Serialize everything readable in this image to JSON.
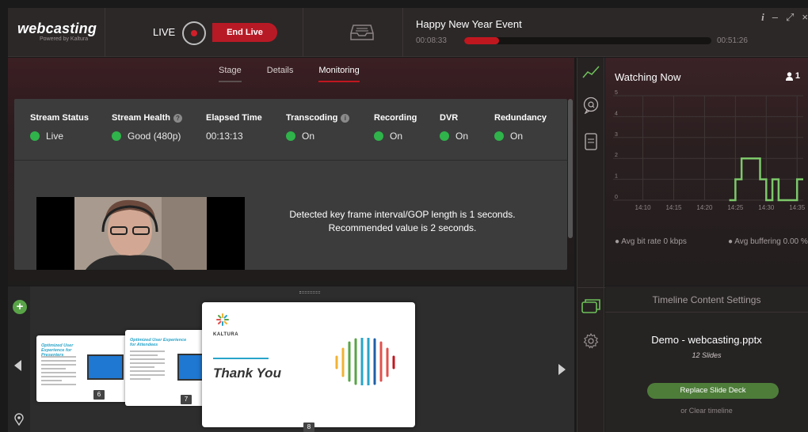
{
  "app": {
    "brand": "webcasting",
    "brand_sub": "Powered by Kaltura"
  },
  "header": {
    "live_label": "LIVE",
    "end_live_label": "End Live",
    "event_title": "Happy New Year Event",
    "elapsed": "00:08:33",
    "total": "00:51:26",
    "progress_fraction": 0.14,
    "window_controls": [
      "i",
      "–",
      "⤢",
      "×"
    ]
  },
  "stage": {
    "tabs": [
      {
        "label": "Stage",
        "active": false
      },
      {
        "label": "Details",
        "active": false
      },
      {
        "label": "Monitoring",
        "active": true
      }
    ],
    "stats": [
      {
        "header": "Stream Status",
        "value": "Live",
        "info": false
      },
      {
        "header": "Stream Health",
        "value": "Good (480p)",
        "info": true
      },
      {
        "header": "Elapsed Time",
        "value": "00:13:13",
        "info": false
      },
      {
        "header": "Transcoding",
        "value": "On",
        "info": true
      },
      {
        "header": "Recording",
        "value": "On",
        "info": false
      },
      {
        "header": "DVR",
        "value": "On",
        "info": false
      },
      {
        "header": "Redundancy",
        "value": "On",
        "info": false
      }
    ],
    "warning_line1": "Detected key frame interval/GOP length is 1 seconds.",
    "warning_line2": "Recommended value is 2 seconds."
  },
  "watching": {
    "title": "Watching Now",
    "viewer_count": "1",
    "avg_bit_rate": "Avg bit rate 0 kbps",
    "avg_buffering": "Avg buffering 0.00 %"
  },
  "chart_data": {
    "type": "line",
    "x_ticks": [
      "14:10",
      "14:15",
      "14:20",
      "14:25",
      "14:30",
      "14:35"
    ],
    "y_ticks": [
      "0",
      "1",
      "2",
      "3",
      "4",
      "5"
    ],
    "ylim": [
      0,
      5
    ],
    "color": "#7cc86a",
    "x": [
      "14:24",
      "14:25",
      "14:26",
      "14:27",
      "14:28",
      "14:29",
      "14:30",
      "14:31",
      "14:32",
      "14:33",
      "14:34",
      "14:35",
      "14:36"
    ],
    "values": [
      0,
      1,
      2,
      2,
      2,
      1,
      0,
      1,
      0,
      0,
      0,
      1,
      1
    ]
  },
  "slides": {
    "thumbs": [
      {
        "number": "6",
        "title": "Optimized User Experience for Presenters"
      },
      {
        "number": "7",
        "title": "Optimized User Experience for Attendees"
      }
    ],
    "current": {
      "number": "8",
      "logo_text": "KALTURA",
      "heading": "Thank You"
    }
  },
  "timeline": {
    "title": "Timeline Content Settings",
    "deck_name": "Demo - webcasting.pptx",
    "slide_count": "12 Slides",
    "replace_label": "Replace Slide Deck",
    "clear_label": "or Clear timeline"
  }
}
